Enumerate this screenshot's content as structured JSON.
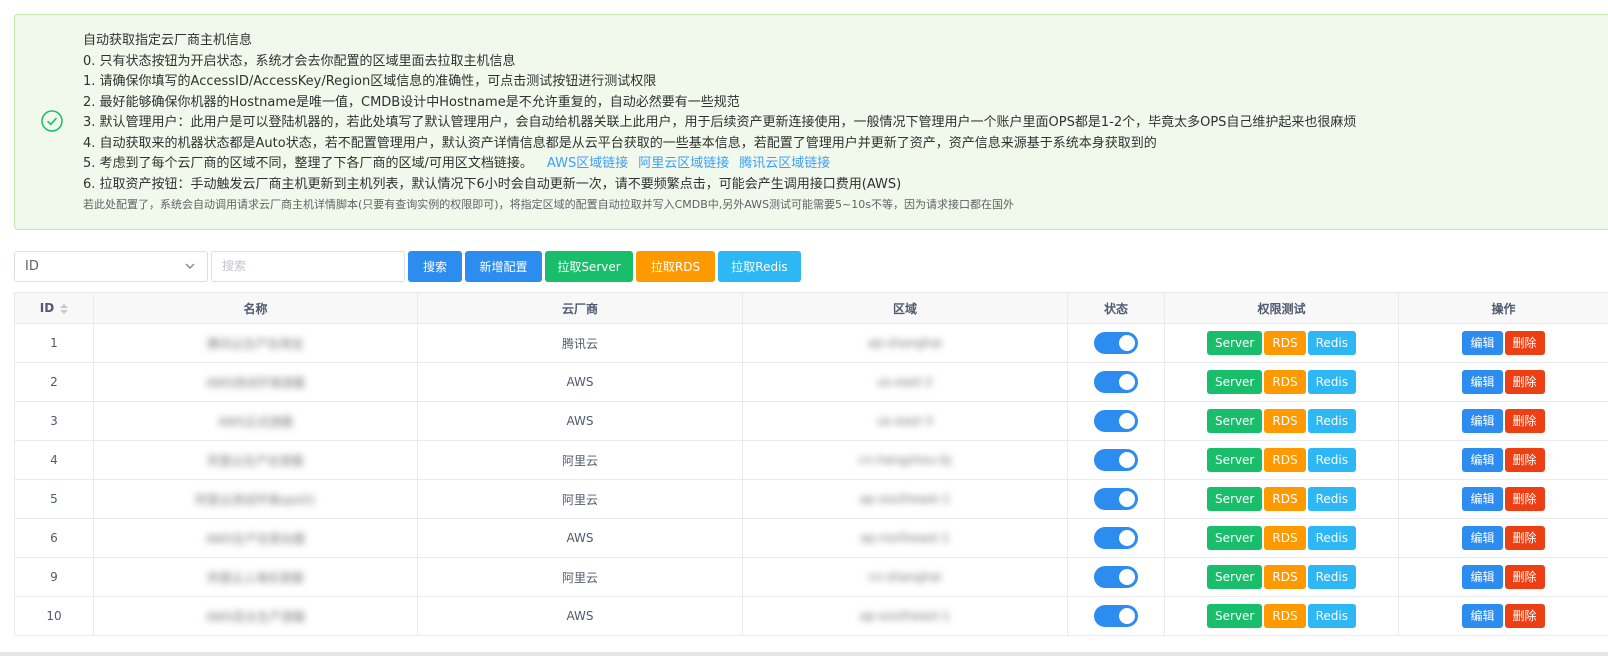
{
  "notice": {
    "lines": [
      "自动获取指定云厂商主机信息",
      "0. 只有状态按钮为开启状态，系统才会去你配置的区域里面去拉取主机信息",
      "1. 请确保你填写的AccessID/AccessKey/Region区域信息的准确性，可点击测试按钮进行测试权限",
      "2. 最好能够确保你机器的Hostname是唯一值，CMDB设计中Hostname是不允许重复的，自动必然要有一些规范",
      "3. 默认管理用户：此用户是可以登陆机器的，若此处填写了默认管理用户，会自动给机器关联上此用户，用于后续资产更新连接使用，一般情况下管理用户一个账户里面OPS都是1-2个，毕竟太多OPS自己维护起来也很麻烦",
      "4. 自动获取来的机器状态都是Auto状态，若不配置管理用户，默认资产详情信息都是从云平台获取的一些基本信息，若配置了管理用户并更新了资产，资产信息来源基于系统本身获取到的",
      "5. 考虑到了每个云厂商的区域不同，整理了下各厂商的区域/可用区文档链接。",
      "6. 拉取资产按钮：手动触发云厂商主机更新到主机列表，默认情况下6小时会自动更新一次，请不要频繁点击，可能会产生调用接口费用(AWS)"
    ],
    "links": [
      "AWS区域链接",
      "阿里云区域链接",
      "腾讯云区域链接"
    ],
    "footnote": "若此处配置了，系统会自动调用请求云厂商主机详情脚本(只要有查询实例的权限即可)，将指定区域的配置自动拉取并写入CMDB中,另外AWS测试可能需要5~10s不等，因为请求接口都在国外"
  },
  "toolbar": {
    "select_value": "ID",
    "search_placeholder": "搜索",
    "search_label": "搜索",
    "add_label": "新增配置",
    "pull_server_label": "拉取Server",
    "pull_rds_label": "拉取RDS",
    "pull_redis_label": "拉取Redis"
  },
  "table": {
    "headers": [
      "ID",
      "名称",
      "云厂商",
      "区域",
      "状态",
      "权限测试",
      "操作"
    ],
    "test_buttons": [
      "Server",
      "RDS",
      "Redis"
    ],
    "edit_label": "编辑",
    "delete_label": "删除",
    "rows": [
      {
        "id": "1",
        "name": "腾讯云生产在用宝",
        "vendor": "腾讯云",
        "region": "ap-shanghai",
        "enabled": true
      },
      {
        "id": "2",
        "name": "AWS测试环境游服",
        "vendor": "AWS",
        "region": "us-east-2",
        "enabled": true
      },
      {
        "id": "3",
        "name": "AWS正式游服",
        "vendor": "AWS",
        "region": "us-east-3",
        "enabled": true
      },
      {
        "id": "4",
        "name": "阿里云生产在营服",
        "vendor": "阿里云",
        "region": "cn-hangzhou-bj",
        "enabled": true
      },
      {
        "id": "5",
        "name": "阿里云测试环境ops01",
        "vendor": "阿里云",
        "region": "ap-southeast-1",
        "enabled": true
      },
      {
        "id": "6",
        "name": "AWS生产在营台服",
        "vendor": "AWS",
        "region": "ap-northeast-1",
        "enabled": true
      },
      {
        "id": "9",
        "name": "阿里云上海在营服",
        "vendor": "阿里云",
        "region": "cn-shanghai",
        "enabled": true
      },
      {
        "id": "10",
        "name": "AWS亚太生产游服",
        "vendor": "AWS",
        "region": "ap-southeast-1",
        "enabled": true
      }
    ]
  }
}
